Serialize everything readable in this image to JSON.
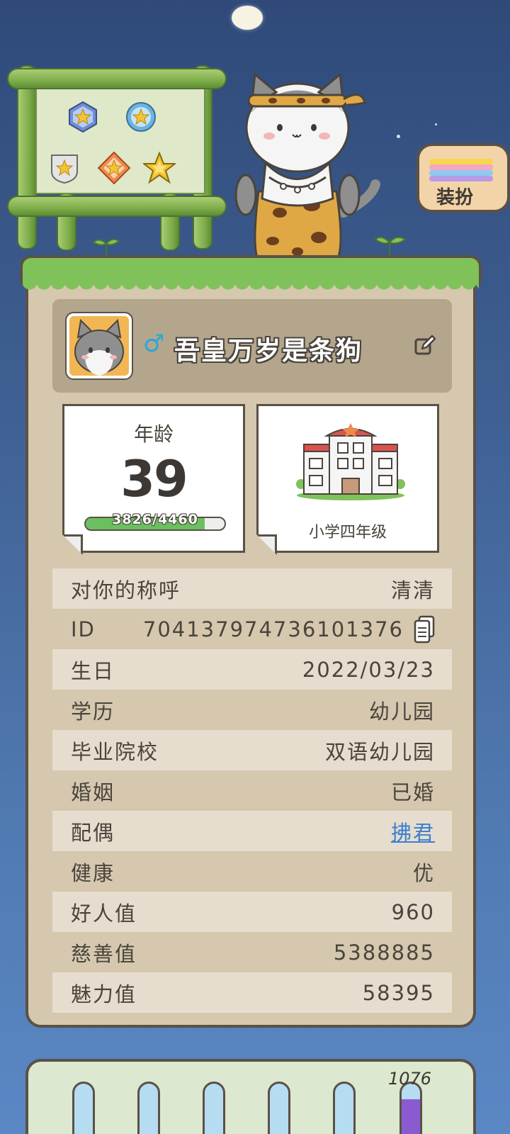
{
  "dress_up": {
    "label": "装扮"
  },
  "profile": {
    "gender_symbol": "♂",
    "nickname": "吾皇万岁是条狗"
  },
  "age_card": {
    "label": "年龄",
    "value": "39",
    "progress_text": "3826/4460",
    "progress_fraction": 0.858
  },
  "school_card": {
    "label": "小学四年级"
  },
  "info_rows": [
    {
      "key": "对你的称呼",
      "value": "清清"
    },
    {
      "key": "ID",
      "value": "7041379747361013​76"
    },
    {
      "key": "生日",
      "value": "2022/03/23"
    },
    {
      "key": "学历",
      "value": "幼儿园"
    },
    {
      "key": "毕业院校",
      "value": "双语幼儿园"
    },
    {
      "key": "婚姻",
      "value": "已婚"
    },
    {
      "key": "配偶",
      "value": "拂君"
    },
    {
      "key": "健康",
      "value": "优"
    },
    {
      "key": "好人值",
      "value": "960"
    },
    {
      "key": "慈善值",
      "value": "5388885"
    },
    {
      "key": "魅力值",
      "value": "58395"
    }
  ],
  "bottom_panel": {
    "number": "1076"
  },
  "colors": {
    "card_bg": "#d5c8ae",
    "stripe": "#e6ddce",
    "link": "#3b7fd0",
    "grass": "#7fc25a",
    "outline": "#5b5147"
  },
  "icons": [
    "gender-male-icon",
    "edit-icon",
    "copy-icon",
    "school-building-icon",
    "star-badge-icon"
  ]
}
